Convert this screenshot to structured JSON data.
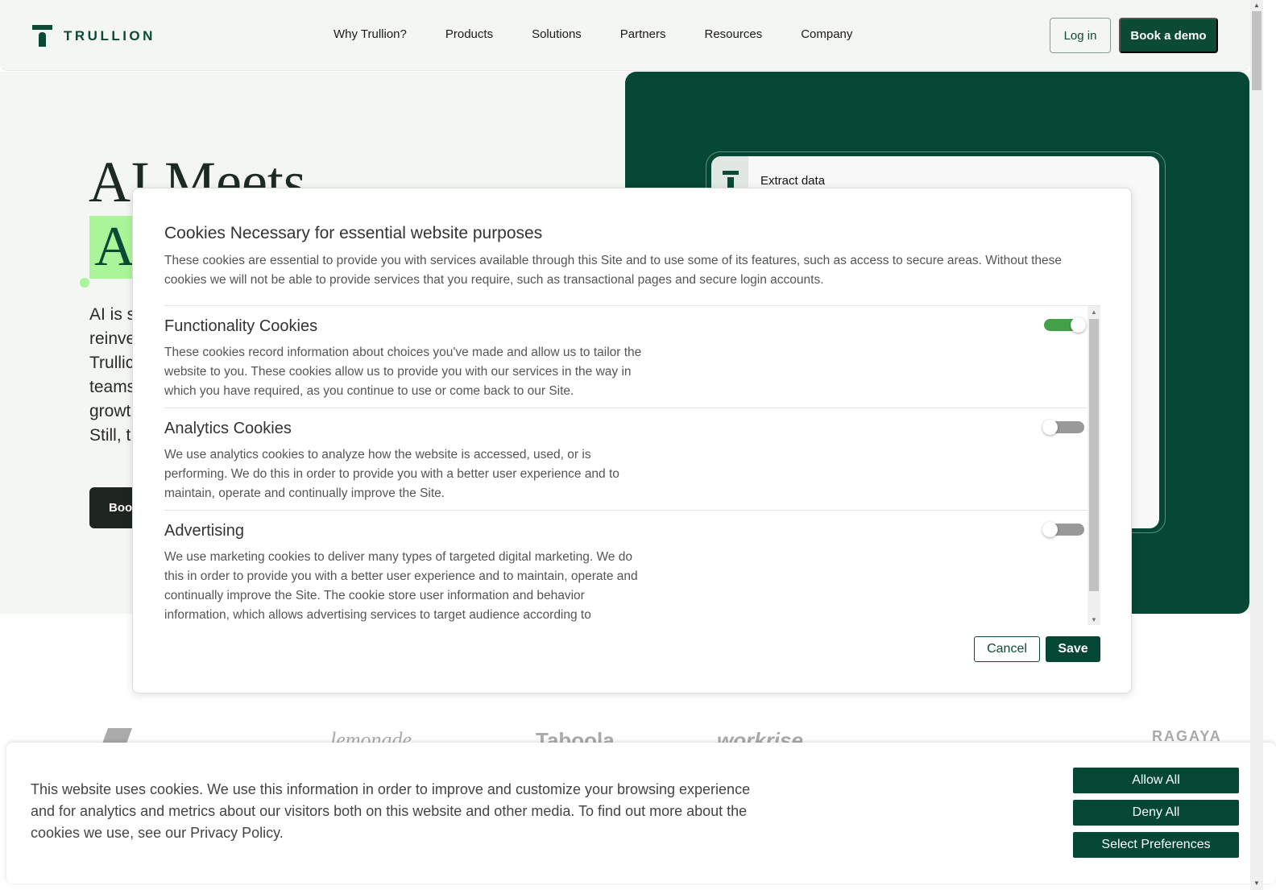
{
  "header": {
    "logo": "TRULLION",
    "nav": [
      "Why Trullion?",
      "Products",
      "Solutions",
      "Partners",
      "Resources",
      "Company"
    ],
    "login": "Log in",
    "book_demo": "Book a demo"
  },
  "hero": {
    "title_line1": "AI Meets",
    "highlight": "A",
    "lead": [
      "AI is s",
      "reinve",
      "Trullic",
      "teams",
      "growt",
      "Still, t"
    ],
    "button": "Book",
    "mockup_title": "Extract data"
  },
  "logos": [
    "lemonade",
    "Taboola",
    "workrise",
    "RAGAYA"
  ],
  "modal": {
    "title": "Cookies Necessary for essential website purposes",
    "desc": "These cookies are essential to provide you with services available through this Site and to use some of its features, such as access to secure areas. Without these cookies we will not be able to provide services that you require, such as transactional pages and secure login accounts.",
    "sections": [
      {
        "title": "Functionality Cookies",
        "desc": "These cookies record information about choices you've made and allow us to tailor the website to you. These cookies allow us to provide you with our services in the way in which you have required, as you continue to use or come back to our Site.",
        "enabled": true
      },
      {
        "title": "Analytics Cookies",
        "desc": "We use analytics cookies to analyze how the website is accessed, used, or is performing. We do this in order to provide you with a better user experience and to maintain, operate and continually improve the Site.",
        "enabled": false
      },
      {
        "title": "Advertising",
        "desc": "We use marketing cookies to deliver many types of targeted digital marketing. We do this in order to provide you with a better user experience and to maintain, operate and continually improve the Site. The cookie store user information and behavior information, which allows advertising services to target audience according to",
        "enabled": false
      }
    ],
    "cancel": "Cancel",
    "save": "Save"
  },
  "banner": {
    "text": "This website uses cookies. We use this information in order to improve and customize your browsing experience and for analytics and metrics about our visitors both on this website and other media. To find out more about the cookies we use, see our Privacy Policy.",
    "allow_all": "Allow All",
    "deny_all": "Deny All",
    "select_prefs": "Select Preferences"
  },
  "colors": {
    "brand": "#034734",
    "highlight": "#aaf59a",
    "toggle_on": "#43a047"
  }
}
